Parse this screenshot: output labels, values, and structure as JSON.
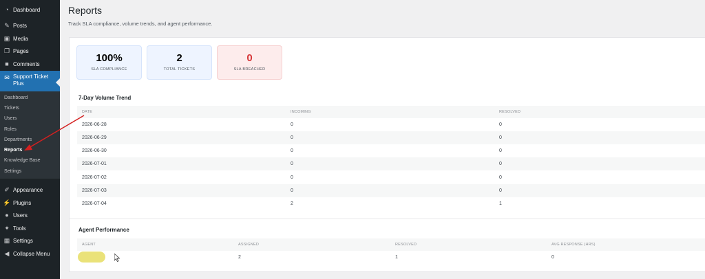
{
  "sidebar": {
    "items": [
      {
        "label": "Dashboard",
        "icon": "dashboard-icon"
      },
      {
        "label": "Posts",
        "icon": "pin-icon"
      },
      {
        "label": "Media",
        "icon": "media-icon"
      },
      {
        "label": "Pages",
        "icon": "pages-icon"
      },
      {
        "label": "Comments",
        "icon": "comment-icon"
      },
      {
        "label": "Support Ticket Plus",
        "icon": "ticket-icon"
      },
      {
        "label": "Appearance",
        "icon": "brush-icon"
      },
      {
        "label": "Plugins",
        "icon": "plugin-icon"
      },
      {
        "label": "Users",
        "icon": "user-icon"
      },
      {
        "label": "Tools",
        "icon": "wrench-icon"
      },
      {
        "label": "Settings",
        "icon": "settings-icon"
      },
      {
        "label": "Collapse Menu",
        "icon": "collapse-icon"
      }
    ],
    "submenu": [
      "Dashboard",
      "Tickets",
      "Users",
      "Roles",
      "Departments",
      "Reports",
      "Knowledge Base",
      "Settings"
    ]
  },
  "page": {
    "title": "Reports",
    "subtitle": "Track SLA compliance, volume trends, and agent performance."
  },
  "stats": [
    {
      "value": "100%",
      "label": "SLA COMPLIANCE",
      "color": "#1d2327"
    },
    {
      "value": "2",
      "label": "TOTAL TICKETS",
      "color": "#1d2327"
    },
    {
      "value": "0",
      "label": "SLA BREACHED",
      "color": "#d63638"
    }
  ],
  "volume": {
    "title": "7-Day Volume Trend",
    "headers": [
      "DATE",
      "INCOMING",
      "RESOLVED"
    ],
    "rows": [
      [
        "2026-06-28",
        "0",
        "0"
      ],
      [
        "2026-06-29",
        "0",
        "0"
      ],
      [
        "2026-06-30",
        "0",
        "0"
      ],
      [
        "2026-07-01",
        "0",
        "0"
      ],
      [
        "2026-07-02",
        "0",
        "0"
      ],
      [
        "2026-07-03",
        "0",
        "0"
      ],
      [
        "2026-07-04",
        "2",
        "1"
      ]
    ]
  },
  "agents": {
    "title": "Agent Performance",
    "headers": [
      "AGENT",
      "ASSIGNED",
      "RESOLVED",
      "AVG RESPONSE (HRS)"
    ],
    "rows": [
      [
        "",
        "2",
        "1",
        "0"
      ]
    ]
  },
  "colors": {
    "sidebar_bg": "#1d2327",
    "accent": "#2271b1",
    "danger": "#d63638",
    "annotation": "#d42020"
  }
}
